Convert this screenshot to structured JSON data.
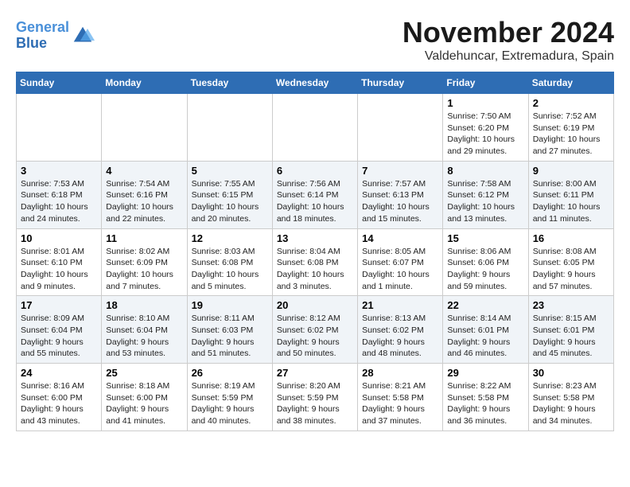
{
  "header": {
    "logo_line1": "General",
    "logo_line2": "Blue",
    "month": "November 2024",
    "location": "Valdehuncar, Extremadura, Spain"
  },
  "weekdays": [
    "Sunday",
    "Monday",
    "Tuesday",
    "Wednesday",
    "Thursday",
    "Friday",
    "Saturday"
  ],
  "weeks": [
    [
      {
        "day": "",
        "info": ""
      },
      {
        "day": "",
        "info": ""
      },
      {
        "day": "",
        "info": ""
      },
      {
        "day": "",
        "info": ""
      },
      {
        "day": "",
        "info": ""
      },
      {
        "day": "1",
        "info": "Sunrise: 7:50 AM\nSunset: 6:20 PM\nDaylight: 10 hours and 29 minutes."
      },
      {
        "day": "2",
        "info": "Sunrise: 7:52 AM\nSunset: 6:19 PM\nDaylight: 10 hours and 27 minutes."
      }
    ],
    [
      {
        "day": "3",
        "info": "Sunrise: 7:53 AM\nSunset: 6:18 PM\nDaylight: 10 hours and 24 minutes."
      },
      {
        "day": "4",
        "info": "Sunrise: 7:54 AM\nSunset: 6:16 PM\nDaylight: 10 hours and 22 minutes."
      },
      {
        "day": "5",
        "info": "Sunrise: 7:55 AM\nSunset: 6:15 PM\nDaylight: 10 hours and 20 minutes."
      },
      {
        "day": "6",
        "info": "Sunrise: 7:56 AM\nSunset: 6:14 PM\nDaylight: 10 hours and 18 minutes."
      },
      {
        "day": "7",
        "info": "Sunrise: 7:57 AM\nSunset: 6:13 PM\nDaylight: 10 hours and 15 minutes."
      },
      {
        "day": "8",
        "info": "Sunrise: 7:58 AM\nSunset: 6:12 PM\nDaylight: 10 hours and 13 minutes."
      },
      {
        "day": "9",
        "info": "Sunrise: 8:00 AM\nSunset: 6:11 PM\nDaylight: 10 hours and 11 minutes."
      }
    ],
    [
      {
        "day": "10",
        "info": "Sunrise: 8:01 AM\nSunset: 6:10 PM\nDaylight: 10 hours and 9 minutes."
      },
      {
        "day": "11",
        "info": "Sunrise: 8:02 AM\nSunset: 6:09 PM\nDaylight: 10 hours and 7 minutes."
      },
      {
        "day": "12",
        "info": "Sunrise: 8:03 AM\nSunset: 6:08 PM\nDaylight: 10 hours and 5 minutes."
      },
      {
        "day": "13",
        "info": "Sunrise: 8:04 AM\nSunset: 6:08 PM\nDaylight: 10 hours and 3 minutes."
      },
      {
        "day": "14",
        "info": "Sunrise: 8:05 AM\nSunset: 6:07 PM\nDaylight: 10 hours and 1 minute."
      },
      {
        "day": "15",
        "info": "Sunrise: 8:06 AM\nSunset: 6:06 PM\nDaylight: 9 hours and 59 minutes."
      },
      {
        "day": "16",
        "info": "Sunrise: 8:08 AM\nSunset: 6:05 PM\nDaylight: 9 hours and 57 minutes."
      }
    ],
    [
      {
        "day": "17",
        "info": "Sunrise: 8:09 AM\nSunset: 6:04 PM\nDaylight: 9 hours and 55 minutes."
      },
      {
        "day": "18",
        "info": "Sunrise: 8:10 AM\nSunset: 6:04 PM\nDaylight: 9 hours and 53 minutes."
      },
      {
        "day": "19",
        "info": "Sunrise: 8:11 AM\nSunset: 6:03 PM\nDaylight: 9 hours and 51 minutes."
      },
      {
        "day": "20",
        "info": "Sunrise: 8:12 AM\nSunset: 6:02 PM\nDaylight: 9 hours and 50 minutes."
      },
      {
        "day": "21",
        "info": "Sunrise: 8:13 AM\nSunset: 6:02 PM\nDaylight: 9 hours and 48 minutes."
      },
      {
        "day": "22",
        "info": "Sunrise: 8:14 AM\nSunset: 6:01 PM\nDaylight: 9 hours and 46 minutes."
      },
      {
        "day": "23",
        "info": "Sunrise: 8:15 AM\nSunset: 6:01 PM\nDaylight: 9 hours and 45 minutes."
      }
    ],
    [
      {
        "day": "24",
        "info": "Sunrise: 8:16 AM\nSunset: 6:00 PM\nDaylight: 9 hours and 43 minutes."
      },
      {
        "day": "25",
        "info": "Sunrise: 8:18 AM\nSunset: 6:00 PM\nDaylight: 9 hours and 41 minutes."
      },
      {
        "day": "26",
        "info": "Sunrise: 8:19 AM\nSunset: 5:59 PM\nDaylight: 9 hours and 40 minutes."
      },
      {
        "day": "27",
        "info": "Sunrise: 8:20 AM\nSunset: 5:59 PM\nDaylight: 9 hours and 38 minutes."
      },
      {
        "day": "28",
        "info": "Sunrise: 8:21 AM\nSunset: 5:58 PM\nDaylight: 9 hours and 37 minutes."
      },
      {
        "day": "29",
        "info": "Sunrise: 8:22 AM\nSunset: 5:58 PM\nDaylight: 9 hours and 36 minutes."
      },
      {
        "day": "30",
        "info": "Sunrise: 8:23 AM\nSunset: 5:58 PM\nDaylight: 9 hours and 34 minutes."
      }
    ]
  ]
}
